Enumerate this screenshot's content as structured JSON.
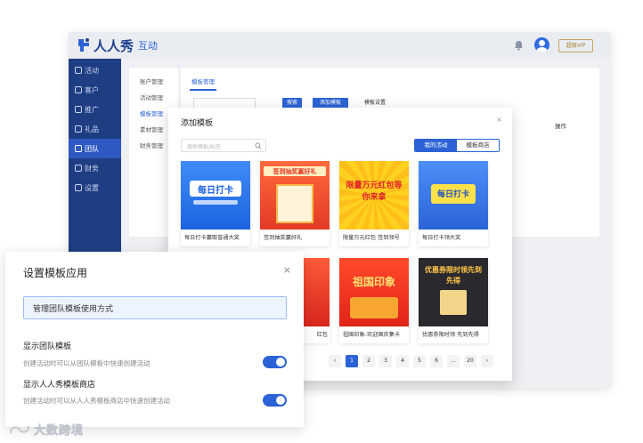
{
  "header": {
    "brand": "人人秀",
    "brand_sub": "互动",
    "vip_label": "超级VIP"
  },
  "sidebar": {
    "items": [
      {
        "label": "活动"
      },
      {
        "label": "客户"
      },
      {
        "label": "推广"
      },
      {
        "label": "礼品"
      },
      {
        "label": "团队"
      },
      {
        "label": "财务"
      },
      {
        "label": "设置"
      }
    ]
  },
  "subnav": {
    "items": [
      {
        "label": "账户管理"
      },
      {
        "label": "活动管理"
      },
      {
        "label": "模板管理"
      },
      {
        "label": "素材管理"
      },
      {
        "label": "财务管理"
      }
    ]
  },
  "content": {
    "tab": "模板管理",
    "btn_search": "搜索",
    "btn_add": "添加模板",
    "btn_settings": "模板设置",
    "col_action": "操作"
  },
  "modal": {
    "title": "添加模板",
    "close": "×",
    "search_placeholder": "搜索模板/标签",
    "tabs": [
      "我的活动",
      "模板商店"
    ],
    "cards": [
      {
        "label": "每日打卡赢取普通大奖",
        "art": "每日打卡"
      },
      {
        "label": "签到抽奖赢好礼",
        "art": "签到抽奖赢好礼"
      },
      {
        "label": "限量万元红包 签到领号",
        "art": "限量万元红包等你来拿"
      },
      {
        "label": "每日打卡领大奖",
        "art": "每日打卡"
      },
      {
        "label": "红包",
        "art": ""
      },
      {
        "label": "祖国印象-欢迎国庆集卡",
        "art": "祖国印象"
      },
      {
        "label": "优惠券限时领 先到先得",
        "art": "优惠券限时领先到先得"
      }
    ],
    "pagination": [
      "‹",
      "1",
      "2",
      "3",
      "4",
      "5",
      "6",
      "...",
      "20",
      "›"
    ]
  },
  "settings_panel": {
    "title": "设置模板应用",
    "close": "×",
    "highlight": "管理团队模板使用方式",
    "options": [
      {
        "title": "显示团队模板",
        "desc": "创建活动时可以从团队模板中快速创建活动",
        "enabled": true
      },
      {
        "title": "显示人人秀模板商店",
        "desc": "创建活动时可以从人人秀模板商店中快速创建活动",
        "enabled": true
      }
    ]
  },
  "watermark": "大数跨境",
  "colors": {
    "primary": "#2b63d6",
    "sidebar": "#1f3d82",
    "brand": "#1c3f8f"
  }
}
